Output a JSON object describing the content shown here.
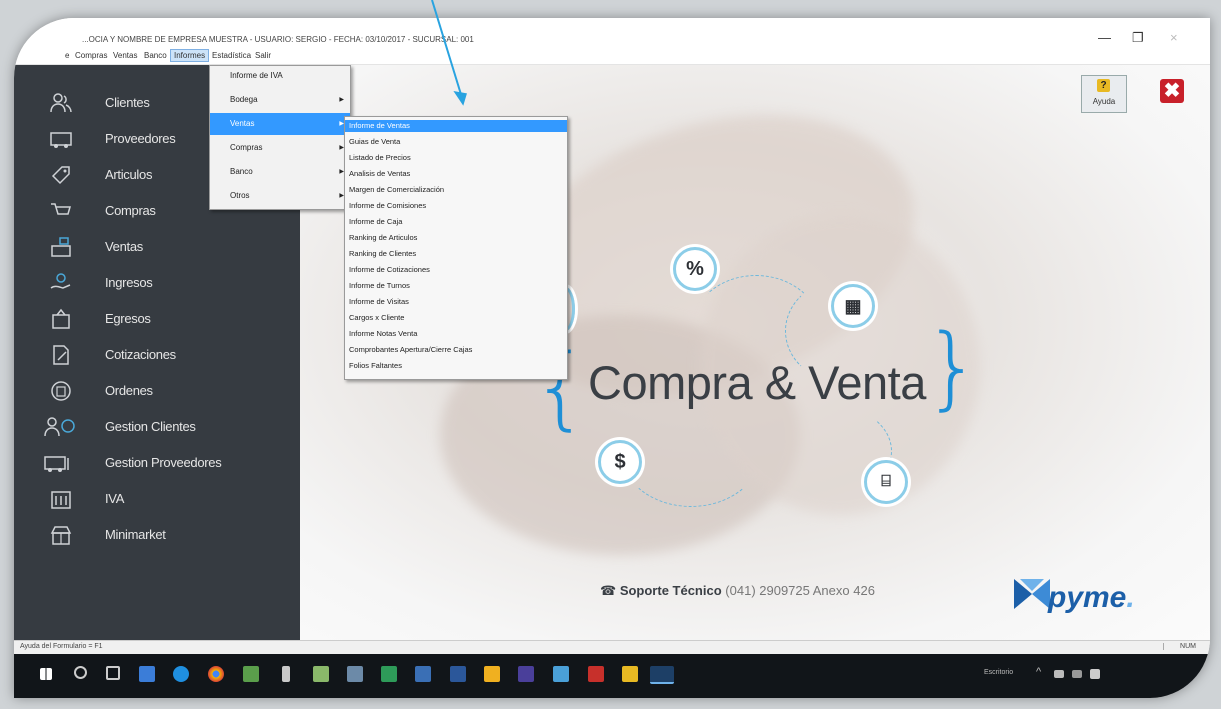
{
  "window": {
    "title": "...OCIA Y NOMBRE DE EMPRESA MUESTRA - USUARIO: SERGIO - FECHA: 03/10/2017 - SUCURSAL: 001",
    "controls": [
      "—",
      "❐",
      "×"
    ]
  },
  "menubar": {
    "items": [
      "e",
      "Compras",
      "Ventas",
      "Banco",
      "Informes",
      "Estadística",
      "Salir"
    ],
    "active": "Informes"
  },
  "sidebar": {
    "items": [
      {
        "label": "Clientes",
        "icon": "users-icon"
      },
      {
        "label": "Proveedores",
        "icon": "truck-icon"
      },
      {
        "label": "Articulos",
        "icon": "tag-icon"
      },
      {
        "label": "Compras",
        "icon": "cart-icon"
      },
      {
        "label": "Ventas",
        "icon": "register-icon"
      },
      {
        "label": "Ingresos",
        "icon": "hand-money-icon"
      },
      {
        "label": "Egresos",
        "icon": "box-out-icon"
      },
      {
        "label": "Cotizaciones",
        "icon": "document-edit-icon"
      },
      {
        "label": "Ordenes",
        "icon": "clipboard-icon"
      },
      {
        "label": "Gestion Clientes",
        "icon": "client-management-icon"
      },
      {
        "label": "Gestion Proveedores",
        "icon": "supplier-management-icon"
      },
      {
        "label": "IVA",
        "icon": "tax-icon"
      },
      {
        "label": "Minimarket",
        "icon": "store-icon"
      }
    ]
  },
  "informes_menu": {
    "items": [
      {
        "label": "Informe de IVA",
        "submenu": false
      },
      {
        "label": "Bodega",
        "submenu": true
      },
      {
        "label": "Ventas",
        "submenu": true,
        "selected": true
      },
      {
        "label": "Compras",
        "submenu": true
      },
      {
        "label": "Banco",
        "submenu": true
      },
      {
        "label": "Otros",
        "submenu": true
      }
    ]
  },
  "ventas_submenu": {
    "items": [
      "Informe de Ventas",
      "Guias de Venta",
      "Listado de Precios",
      "Analisis de Ventas",
      "Margen de Comercialización",
      "Informe de Comisiones",
      "Informe de Caja",
      "Ranking de Articulos",
      "Ranking de Clientes",
      "Informe de Cotizaciones",
      "Informe de Turnos",
      "Informe de Visitas",
      "Cargos x Cliente",
      "Informe Notas Venta",
      "Comprobantes Apertura/Cierre Cajas",
      "Folios Faltantes"
    ],
    "selected_index": 0
  },
  "main": {
    "logo_text": "Compra & Venta",
    "brace_open": "{",
    "brace_close": "}",
    "percent_symbol": "%",
    "dollar_symbol": "$",
    "support_label": "Soporte Técnico",
    "support_phone": "(041) 2909725 Anexo 426",
    "help_label": "Ayuda",
    "help_glyph": "?",
    "close_glyph": "✖",
    "brand": "pyme",
    "brand_dot": ".",
    "accent_color": "#1e8fd6"
  },
  "statusbar": {
    "left": "Ayuda del Formulario = F1",
    "right": "NUM"
  },
  "taskbar": {
    "tray_text": "Escritorio",
    "tray_chevron": "^"
  }
}
